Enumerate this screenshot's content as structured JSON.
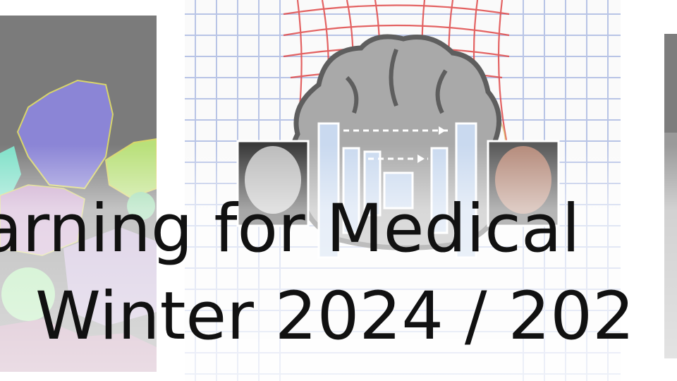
{
  "banner": {
    "title_line1": "arning for Medical",
    "title_line2": "Winter 2024 / 202"
  },
  "colors": {
    "text": "#111111",
    "background": "#ffffff",
    "cell_purple": "#8b85d6",
    "cell_green": "#b9e07a",
    "cell_teal": "#7fe0c8",
    "grid_red": "#e03a3a",
    "grid_blue": "#8aa0e0",
    "brain_gray": "#a9a9a9",
    "network_blue": "#c9d9ef"
  },
  "images": {
    "left": "cell-microscopy-image",
    "center": "brain-deformation-grid-network-diagram",
    "right": "partial-medical-image"
  }
}
